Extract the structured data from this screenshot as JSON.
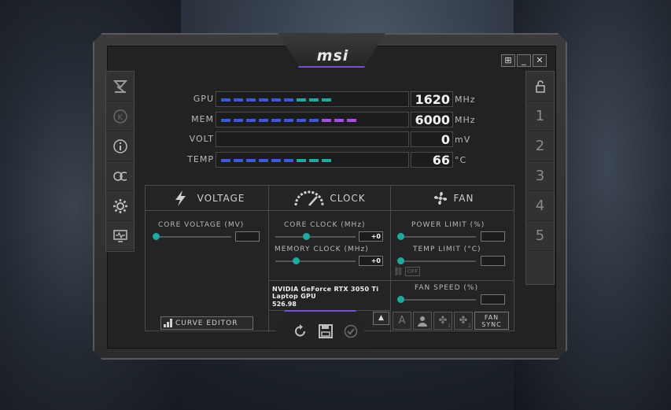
{
  "app": {
    "logo_text": "msi"
  },
  "window_buttons": {
    "minimize": "_",
    "close": "✕"
  },
  "meters": [
    {
      "label": "GPU",
      "value": "1620",
      "unit": "MHz",
      "segments": 9,
      "accent": "#1fa9a0"
    },
    {
      "label": "MEM",
      "value": "6000",
      "unit": "MHz",
      "segments": 11,
      "accent": "#a24fe0"
    },
    {
      "label": "VOLT",
      "value": "0",
      "unit": "mV",
      "segments": 0,
      "accent": "#3d5ad9"
    },
    {
      "label": "TEMP",
      "value": "66",
      "unit": "°C",
      "segments": 9,
      "accent": "#1fa9a0"
    }
  ],
  "left_sidebar": [
    "oc-scanner-icon",
    "kombustor-icon",
    "info-icon",
    "oc-icon",
    "settings-icon",
    "monitor-icon"
  ],
  "profiles": [
    "1",
    "2",
    "3",
    "4",
    "5"
  ],
  "voltage": {
    "header": "VOLTAGE",
    "core_voltage_label": "CORE VOLTAGE (MV)",
    "core_voltage_value": "",
    "curve_editor": "CURVE EDITOR"
  },
  "clock": {
    "header": "CLOCK",
    "core_clock_label": "CORE CLOCK (MHz)",
    "core_clock_value": "+0",
    "memory_clock_label": "MEMORY CLOCK (MHz)",
    "memory_clock_value": "+0",
    "gpu_name": "NVIDIA GeForce RTX 3050 Ti Laptop GPU",
    "gpu_value": "526.98"
  },
  "fan": {
    "header": "FAN",
    "power_limit_label": "POWER LIMIT (%)",
    "power_limit_value": "",
    "temp_limit_label": "TEMP LIMIT (°C)",
    "temp_limit_value": "",
    "off_label": "OFF",
    "fan_speed_label": "FAN SPEED (%)",
    "fan_speed_value": "",
    "auto_label": "A",
    "fan1_sub": "1",
    "fan2_sub": "2",
    "fan_sync_line1": "FAN",
    "fan_sync_line2": "SYNC"
  },
  "colors": {
    "accent_teal": "#1fa9a0",
    "accent_blue": "#3d5ad9",
    "accent_purple": "#a24fe0"
  }
}
